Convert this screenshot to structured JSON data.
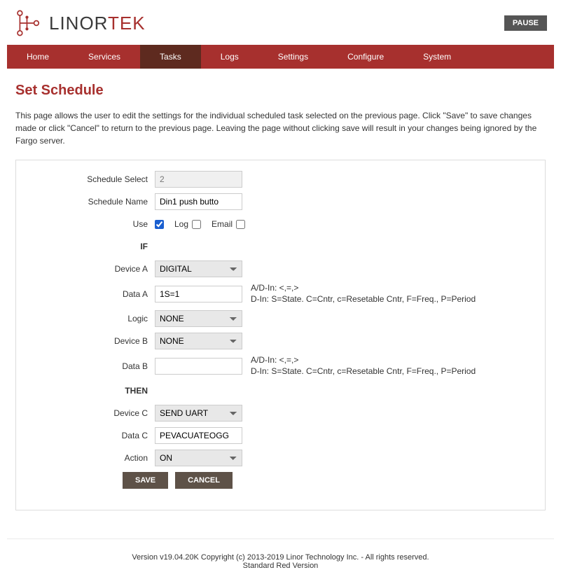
{
  "header": {
    "logo_dark": "LINOR",
    "logo_red": "TEK",
    "pause_label": "PAUSE"
  },
  "nav": {
    "items": [
      {
        "label": "Home"
      },
      {
        "label": "Services"
      },
      {
        "label": "Tasks"
      },
      {
        "label": "Logs"
      },
      {
        "label": "Settings"
      },
      {
        "label": "Configure"
      },
      {
        "label": "System"
      }
    ]
  },
  "page": {
    "title": "Set Schedule",
    "description": "This page allows the user to edit the settings for the individual scheduled task selected on the previous page. Click \"Save\" to save changes made or click \"Cancel\" to return to the previous page. Leaving the page without clicking save will result in your changes being ignored by the Fargo server."
  },
  "form": {
    "schedule_select_label": "Schedule Select",
    "schedule_select_value": "2",
    "schedule_name_label": "Schedule Name",
    "schedule_name_value": "Din1 push butto",
    "use_label": "Use",
    "log_label": "Log",
    "email_label": "Email",
    "if_label": "IF",
    "device_a_label": "Device A",
    "device_a_value": "DIGITAL",
    "data_a_label": "Data A",
    "data_a_value": "1S=1",
    "hint_a": "A/D-In: <,=,>\nD-In: S=State. C=Cntr, c=Resetable Cntr, F=Freq., P=Period",
    "logic_label": "Logic",
    "logic_value": "NONE",
    "device_b_label": "Device B",
    "device_b_value": "NONE",
    "data_b_label": "Data B",
    "data_b_value": "",
    "hint_b": "A/D-In: <,=,>\nD-In: S=State. C=Cntr, c=Resetable Cntr, F=Freq., P=Period",
    "then_label": "THEN",
    "device_c_label": "Device C",
    "device_c_value": "SEND UART",
    "data_c_label": "Data C",
    "data_c_value": "PEVACUATEOGG",
    "action_label": "Action",
    "action_value": "ON",
    "save_label": "SAVE",
    "cancel_label": "CANCEL"
  },
  "footer": {
    "line1": "Version v19.04.20K Copyright (c) 2013-2019 Linor Technology Inc. - All rights reserved.",
    "line2": "Standard Red Version"
  }
}
